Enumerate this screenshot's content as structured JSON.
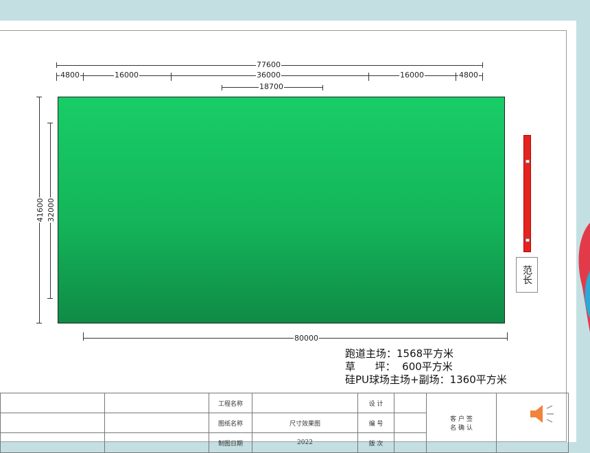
{
  "drawing": {
    "dims_top": {
      "total": "77600",
      "segments": [
        "4800",
        "16000",
        "36000",
        "16000",
        "4800"
      ],
      "inner": "18700"
    },
    "dims_left": {
      "outer": "41600",
      "inner": "32000"
    },
    "dim_bottom": "80000",
    "side_label": "范长",
    "field_color": "#16c160"
  },
  "legend": {
    "line1": "跑道主场：1568平方米",
    "line2": "草      坪：  600平方米",
    "line3": "硅PU球场主场+副场：1360平方米"
  },
  "title_block": {
    "project_name_label": "工程名称",
    "drawing_name_label": "图纸名称",
    "drawing_name_value": "尺寸效果图",
    "date_label": "制图日期",
    "date_value": "2022",
    "design_label": "设  计",
    "number_label": "编  号",
    "revision_label": "版  次",
    "client_label": "客 户 签\n名 确 认"
  },
  "colors": {
    "background": "#c3dfe2",
    "field": "#16c160",
    "red_bar": "#e3231f"
  },
  "icons": {
    "speaker": "speaker-icon"
  }
}
